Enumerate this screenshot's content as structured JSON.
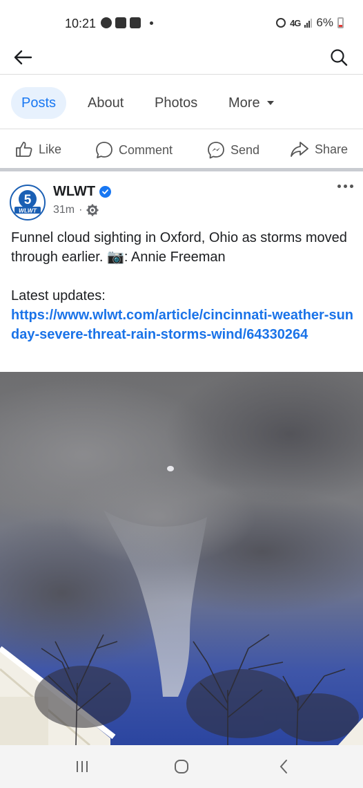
{
  "status_bar": {
    "time": "10:21",
    "network": "4G",
    "battery_percent": "6%",
    "battery_color": "#e53935"
  },
  "top_nav": {
    "back_icon": "arrow-left-icon",
    "search_icon": "search-icon"
  },
  "tabs": [
    {
      "label": "Posts",
      "active": true
    },
    {
      "label": "About",
      "active": false
    },
    {
      "label": "Photos",
      "active": false
    },
    {
      "label": "More",
      "active": false
    }
  ],
  "actions": [
    {
      "label": "Like",
      "icon": "thumbs-up-icon"
    },
    {
      "label": "Comment",
      "icon": "comment-icon"
    },
    {
      "label": "Send",
      "icon": "messenger-icon"
    },
    {
      "label": "Share",
      "icon": "share-icon"
    }
  ],
  "post": {
    "page_name": "WLWT",
    "time_ago": "31m",
    "body_line1": "Funnel cloud sighting in Oxford, Ohio as storms moved through earlier. ",
    "camera_emoji": "📷",
    "body_credit": ": Annie Freeman",
    "updates_label": "Latest updates:",
    "link": "https://www.wlwt.com/article/cincinnati-weather-sunday-severe-threat-rain-storms-wind/64330264",
    "logo_text": "WLWT",
    "logo_number": "5"
  },
  "colors": {
    "accent": "#1877f2",
    "link": "#1a73e8",
    "tab_active_bg": "#e7f1fd"
  }
}
